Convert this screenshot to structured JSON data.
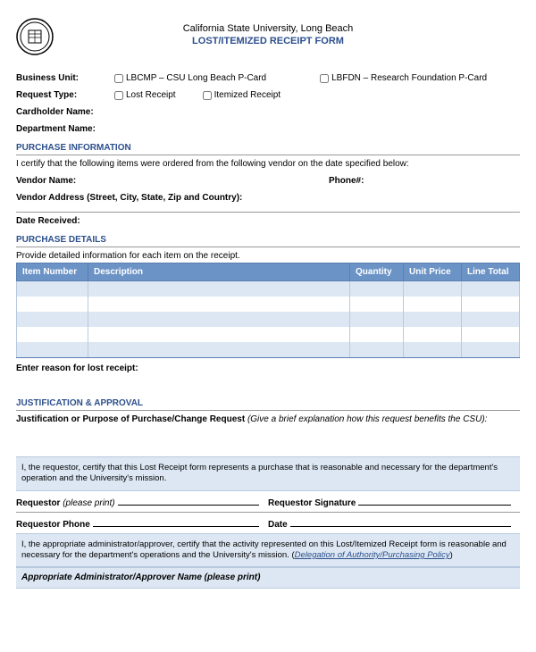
{
  "header": {
    "university": "California State University, Long Beach",
    "form_title": "LOST/ITEMIZED RECEIPT FORM"
  },
  "fields": {
    "business_unit_label": "Business Unit:",
    "business_unit_opts": [
      "LBCMP – CSU Long Beach P-Card",
      "LBFDN – Research Foundation P-Card"
    ],
    "request_type_label": "Request Type:",
    "request_type_opts": [
      "Lost Receipt",
      "Itemized Receipt"
    ],
    "cardholder_label": "Cardholder Name:",
    "department_label": "Department Name:"
  },
  "purchase_info": {
    "title": "PURCHASE INFORMATION",
    "cert": "I certify that the following items were ordered from the following vendor on the date specified below:",
    "vendor_name_label": "Vendor Name:",
    "phone_label": "Phone#:",
    "vendor_address_label": "Vendor Address (Street, City, State, Zip and Country):",
    "date_received_label": "Date Received:"
  },
  "purchase_details": {
    "title": "PURCHASE DETAILS",
    "subtitle": "Provide detailed information for each item on the receipt.",
    "headers": [
      "Item Number",
      "Description",
      "Quantity",
      "Unit Price",
      "Line Total"
    ],
    "row_count": 5,
    "reason_label": "Enter reason for lost receipt:"
  },
  "justification": {
    "title": "JUSTIFICATION & APPROVAL",
    "just_label": "Justification or Purpose of Purchase/Change Request",
    "just_hint": " (Give a brief explanation how this request benefits the CSU):",
    "cert1": "I, the requestor, certify that this Lost Receipt form represents a purchase that is reasonable and necessary for the department's operation and the University's mission.",
    "requestor_print_label": "Requestor",
    "please_print": " (please print)",
    "requestor_sig_label": "Requestor Signature",
    "requestor_phone_label": "Requestor Phone",
    "date_label": "Date",
    "cert2_pre": "I, the appropriate administrator/approver, certify that the activity represented on this Lost/Itemized Receipt form is reasonable and necessary for the department's operations and the University's mission. (",
    "cert2_link": "Delegation of Authority/Purchasing Policy",
    "cert2_post": ")",
    "admin_label": "Appropriate Administrator/Approver Name (please print)"
  }
}
